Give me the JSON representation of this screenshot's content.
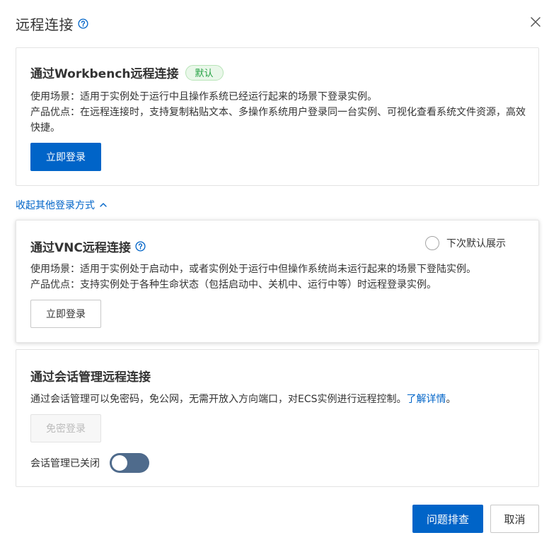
{
  "dialog": {
    "title": "远程连接",
    "help_icon": "question-circle-icon",
    "close_icon": "close-icon"
  },
  "workbench": {
    "title": "通过Workbench远程连接",
    "badge": "默认",
    "scenario": "使用场景：适用于实例处于运行中且操作系统已经运行起来的场景下登录实例。",
    "advantage": "产品优点：在远程连接时，支持复制粘贴文本、多操作系统用户登录同一台实例、可视化查看系统文件资源，高效快捷。",
    "login_button": "立即登录"
  },
  "collapse": {
    "label": "收起其他登录方式",
    "icon": "chevron-up-icon"
  },
  "vnc": {
    "title": "通过VNC远程连接",
    "help_icon": "question-circle-icon",
    "default_radio_label": "下次默认展示",
    "scenario": "使用场景：适用于实例处于启动中，或者实例处于运行中但操作系统尚未运行起来的场景下登陆实例。",
    "advantage": "产品优点：支持实例处于各种生命状态（包括启动中、关机中、运行中等）时远程登录实例。",
    "login_button": "立即登录"
  },
  "session": {
    "title": "通过会话管理远程连接",
    "desc_prefix": "通过会话管理可以免密码，免公网，无需开放入方向端口，对ECS实例进行远程控制。",
    "learn_more": "了解详情",
    "desc_suffix": "。",
    "passwordless_button": "免密登录",
    "toggle_label": "会话管理已关闭"
  },
  "footer": {
    "troubleshoot_button": "问题排查",
    "cancel_button": "取消"
  },
  "colors": {
    "primary": "#0064c8",
    "badge_green": "#25a244",
    "toggle_off": "#4f6b8c"
  }
}
